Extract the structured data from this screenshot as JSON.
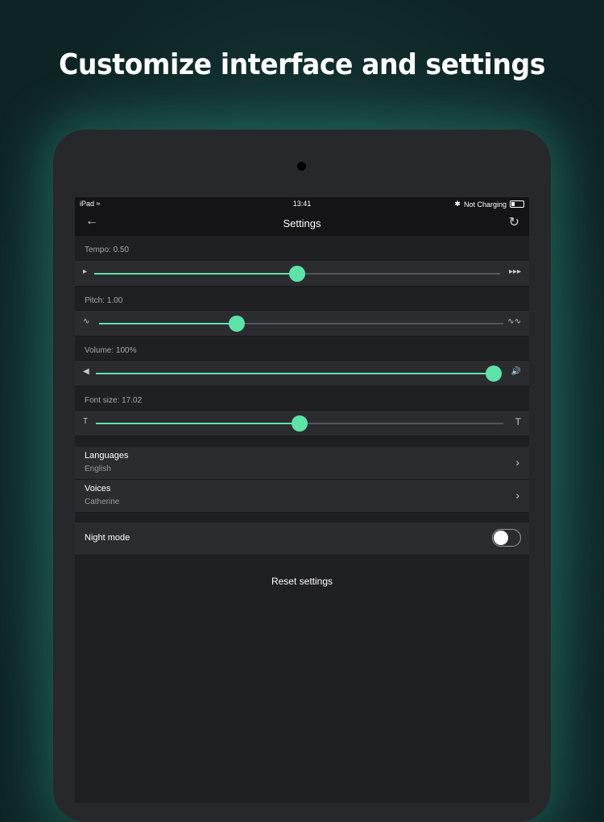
{
  "headline": "Customize interface and settings",
  "status_bar": {
    "device": "iPad",
    "wifi_icon": "wifi-icon",
    "time": "13:41",
    "charging": "Not Charging",
    "bluetooth_icon": "bluetooth-icon"
  },
  "nav": {
    "title": "Settings",
    "back_icon": "arrow-left-icon",
    "reset_icon": "refresh-icon"
  },
  "sliders": [
    {
      "label": "Tempo: 0.50",
      "value": 0.5,
      "left_icon": "play-slow-icon",
      "right_icon": "fast-forward-icon"
    },
    {
      "label": "Pitch: 1.00",
      "value": 0.34,
      "left_icon": "wave-low-icon",
      "right_icon": "wave-high-icon"
    },
    {
      "label": "Volume: 100%",
      "value": 1.0,
      "left_icon": "volume-low-icon",
      "right_icon": "volume-high-icon"
    },
    {
      "label": "Font size: 17.02",
      "value": 0.5,
      "left_icon": "text-small-icon",
      "right_icon": "text-large-icon"
    }
  ],
  "list": [
    {
      "title": "Languages",
      "subtitle": "English"
    },
    {
      "title": "Voices",
      "subtitle": "Catherine"
    }
  ],
  "night_mode": {
    "label": "Night mode",
    "enabled": false
  },
  "reset_label": "Reset settings",
  "colors": {
    "accent": "#5de3a8",
    "background": "#1f2024",
    "row": "#2b2c30"
  }
}
